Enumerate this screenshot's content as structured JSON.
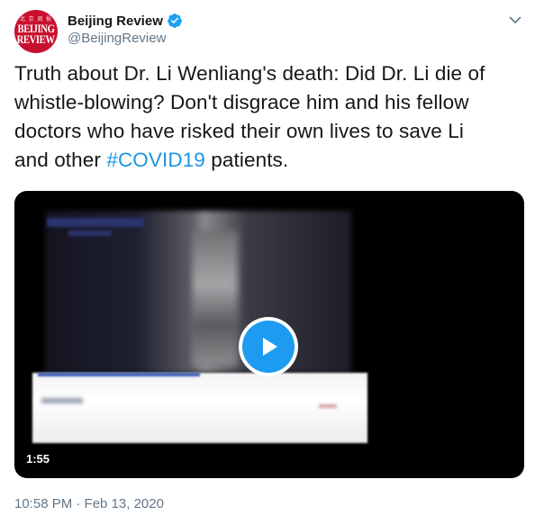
{
  "account": {
    "display_name": "Beijing Review",
    "handle": "@BeijingReview",
    "avatar_line1": "BEIJING",
    "avatar_line2": "REVIEW",
    "verified": true
  },
  "tweet": {
    "text_before": "Truth about Dr. Li Wenliang's death: Did Dr. Li die of whistle-blowing? Don't disgrace him and his fellow doctors who have risked their own lives to save Li and other ",
    "hashtag": "#COVID19",
    "text_after": " patients.",
    "timestamp": "10:58 PM · Feb 13, 2020"
  },
  "media": {
    "type": "video",
    "duration": "1:55",
    "play_icon": "play-icon"
  },
  "colors": {
    "link": "#1b95e0",
    "verified": "#1da1f2",
    "play_button": "#1d9bf0",
    "muted_text": "#657786"
  }
}
